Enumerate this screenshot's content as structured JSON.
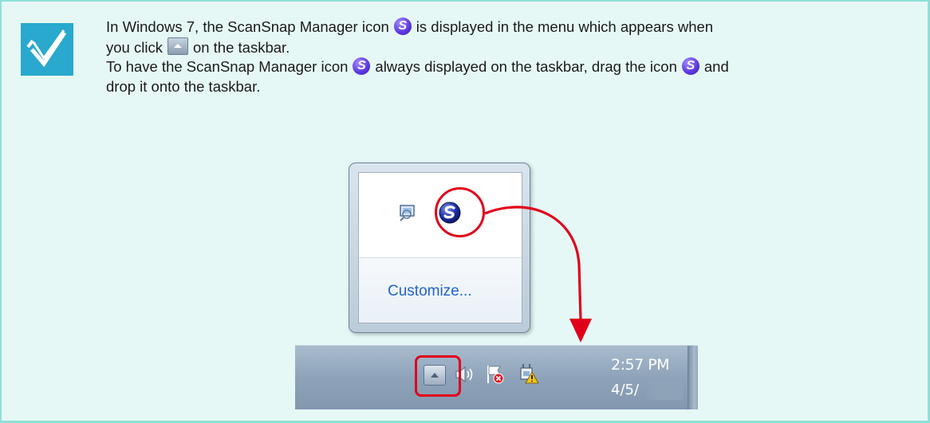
{
  "note": {
    "badge_icon": "checkmark-icon",
    "line1_a": "In Windows 7, the ScanSnap Manager icon",
    "line1_b": "is displayed in the menu which appears when",
    "line2_a": "you click",
    "line2_b": "on the taskbar.",
    "line3_a": "To have the ScanSnap Manager icon",
    "line3_b": "always displayed on the taskbar, drag the icon",
    "line3_c": "and",
    "line4": "drop it onto the taskbar."
  },
  "flyout": {
    "icons": [
      "action-center-icon",
      "scansnap-manager-icon"
    ],
    "customize_label": "Customize..."
  },
  "taskbar": {
    "icons": [
      "show-hidden-icons-button",
      "volume-icon",
      "action-center-flag-icon",
      "network-warning-icon"
    ],
    "time": "2:57 PM",
    "date": "4/5/"
  },
  "colors": {
    "note_background": "#e6f8f6",
    "note_border": "#8fe0d8",
    "badge": "#28a9cd",
    "highlight": "#e1001a",
    "link": "#1f64c8"
  }
}
